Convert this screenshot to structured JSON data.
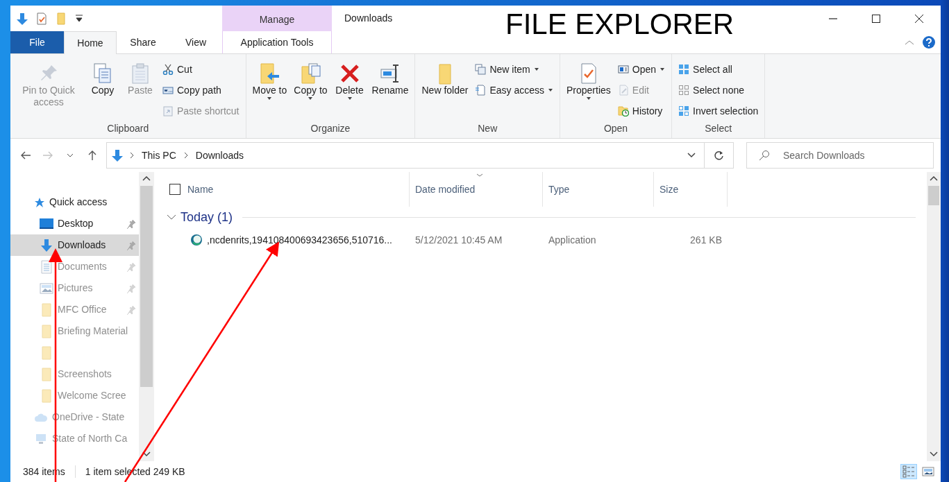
{
  "window": {
    "title": "Downloads",
    "overlay_title": "FILE EXPLORER"
  },
  "context_tab": {
    "label": "Manage"
  },
  "tabs": [
    {
      "label": "File",
      "kind": "file",
      "selected": false
    },
    {
      "label": "Home",
      "kind": "normal",
      "selected": true
    },
    {
      "label": "Share",
      "kind": "normal",
      "selected": false
    },
    {
      "label": "View",
      "kind": "normal",
      "selected": false
    },
    {
      "label": "Application Tools",
      "kind": "context",
      "selected": false
    }
  ],
  "ribbon": {
    "groups": [
      {
        "label": "Clipboard",
        "columns": [
          [
            {
              "label": "Pin to Quick access",
              "kind": "large",
              "disabled": true,
              "dropdown": false
            }
          ],
          [
            {
              "label": "Copy",
              "kind": "large",
              "disabled": false,
              "dropdown": false
            }
          ],
          [
            {
              "label": "Paste",
              "kind": "large",
              "disabled": true,
              "dropdown": false
            }
          ],
          [
            {
              "label": "Cut",
              "kind": "small",
              "disabled": false,
              "dropdown": false
            },
            {
              "label": "Copy path",
              "kind": "small",
              "disabled": false,
              "dropdown": false
            },
            {
              "label": "Paste shortcut",
              "kind": "small",
              "disabled": true,
              "dropdown": false
            }
          ]
        ]
      },
      {
        "label": "Organize",
        "columns": [
          [
            {
              "label": "Move to",
              "kind": "large",
              "disabled": false,
              "dropdown": true
            }
          ],
          [
            {
              "label": "Copy to",
              "kind": "large",
              "disabled": false,
              "dropdown": true
            }
          ],
          [
            {
              "label": "Delete",
              "kind": "large",
              "disabled": false,
              "dropdown": true
            }
          ],
          [
            {
              "label": "Rename",
              "kind": "large",
              "disabled": false,
              "dropdown": false
            }
          ]
        ]
      },
      {
        "label": "New",
        "columns": [
          [
            {
              "label": "New folder",
              "kind": "large",
              "disabled": false,
              "dropdown": false
            }
          ],
          [
            {
              "label": "New item",
              "kind": "small",
              "disabled": false,
              "dropdown": true
            },
            {
              "label": "Easy access",
              "kind": "small",
              "disabled": false,
              "dropdown": true
            }
          ]
        ]
      },
      {
        "label": "Open",
        "columns": [
          [
            {
              "label": "Properties",
              "kind": "large",
              "disabled": false,
              "dropdown": true
            }
          ],
          [
            {
              "label": "Open",
              "kind": "small",
              "disabled": false,
              "dropdown": true
            },
            {
              "label": "Edit",
              "kind": "small",
              "disabled": true,
              "dropdown": false
            },
            {
              "label": "History",
              "kind": "small",
              "disabled": false,
              "dropdown": false
            }
          ]
        ]
      },
      {
        "label": "Select",
        "columns": [
          [
            {
              "label": "Select all",
              "kind": "small",
              "disabled": false,
              "dropdown": false
            },
            {
              "label": "Select none",
              "kind": "small",
              "disabled": false,
              "dropdown": false
            },
            {
              "label": "Invert selection",
              "kind": "small",
              "disabled": false,
              "dropdown": false
            }
          ]
        ]
      }
    ]
  },
  "address_bar": {
    "forward_disabled": true,
    "path": [
      "This PC",
      "Downloads"
    ]
  },
  "search": {
    "placeholder": "Search Downloads"
  },
  "navigation_pane": {
    "items": [
      {
        "label": "Quick access",
        "kind": "header",
        "selected": false,
        "pinned": false,
        "faded": false,
        "pointed_at": false
      },
      {
        "label": "Desktop",
        "kind": "item",
        "selected": false,
        "pinned": true,
        "faded": false,
        "pointed_at": false
      },
      {
        "label": "Downloads",
        "kind": "item",
        "selected": true,
        "pinned": true,
        "faded": false,
        "pointed_at": true
      },
      {
        "label": "Documents",
        "kind": "item",
        "selected": false,
        "pinned": true,
        "faded": true,
        "pointed_at": false
      },
      {
        "label": "Pictures",
        "kind": "item",
        "selected": false,
        "pinned": true,
        "faded": true,
        "pointed_at": false
      },
      {
        "label": "MFC Office",
        "kind": "item",
        "selected": false,
        "pinned": true,
        "faded": true,
        "pointed_at": false
      },
      {
        "label": "Briefing Material",
        "kind": "item",
        "selected": false,
        "pinned": false,
        "faded": true,
        "pointed_at": false
      },
      {
        "kind": "item",
        "selected": false,
        "pinned": false,
        "faded": true,
        "pointed_at": false
      },
      {
        "label": "Screenshots",
        "kind": "item",
        "selected": false,
        "pinned": false,
        "faded": true,
        "pointed_at": false
      },
      {
        "label": "Welcome Scree",
        "kind": "item",
        "selected": false,
        "pinned": false,
        "faded": true,
        "pointed_at": false
      },
      {
        "label": "OneDrive - State",
        "kind": "header",
        "selected": false,
        "pinned": false,
        "faded": true,
        "pointed_at": false
      },
      {
        "label": "State of North Ca",
        "kind": "header",
        "selected": false,
        "pinned": false,
        "faded": true,
        "pointed_at": false
      }
    ]
  },
  "file_list": {
    "columns": [
      "Name",
      "Date modified",
      "Type",
      "Size"
    ],
    "select_all_checked": false,
    "groups": [
      {
        "label": "Today (1)",
        "expanded": true,
        "rows": [
          {
            "name": ",ncdenrits,194108400693423656,510716...",
            "date_modified": "5/12/2021 10:45 AM",
            "type": "Application",
            "size": "261 KB",
            "selected": false,
            "pointed_at": true
          }
        ]
      }
    ]
  },
  "status_bar": {
    "item_count": "384 items",
    "selection": "1 item selected 249 KB"
  },
  "view_buttons": [
    {
      "kind": "details",
      "selected": true
    },
    {
      "kind": "large_icons",
      "selected": false
    }
  ]
}
